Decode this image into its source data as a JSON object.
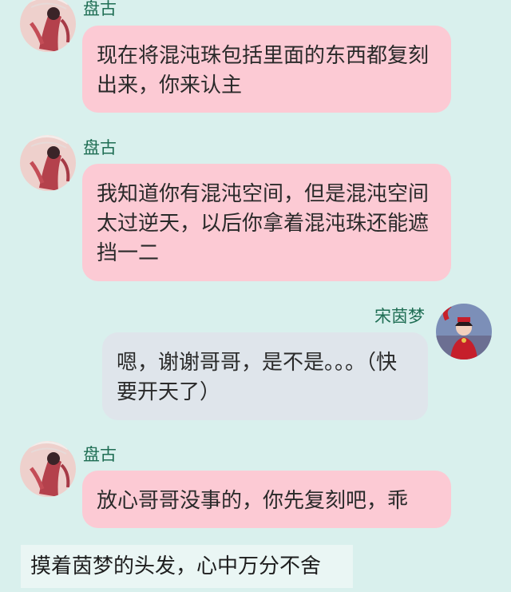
{
  "messages": [
    {
      "sender": "盘古",
      "text": "现在将混沌珠包括里面的东西都复刻出来，你来认主"
    },
    {
      "sender": "盘古",
      "text": "我知道你有混沌空间，但是混沌空间太过逆天，以后你拿着混沌珠还能遮挡一二"
    },
    {
      "sender": "宋茵梦",
      "text": "嗯，谢谢哥哥，是不是。。。（快要开天了）"
    },
    {
      "sender": "盘古",
      "text": "放心哥哥没事的，你先复刻吧，乖"
    }
  ],
  "caption": "摸着茵梦的头发，心中万分不舍",
  "colors": {
    "background": "#d9f0ed",
    "incoming_bubble": "#fccad4",
    "outgoing_bubble": "#dfe5eb",
    "name_text": "#1f6e54",
    "caption_bg": "#eaf6f4"
  },
  "icons": {
    "pangu_avatar": "pangu-avatar",
    "songyinmeng_avatar": "songyinmeng-avatar"
  }
}
